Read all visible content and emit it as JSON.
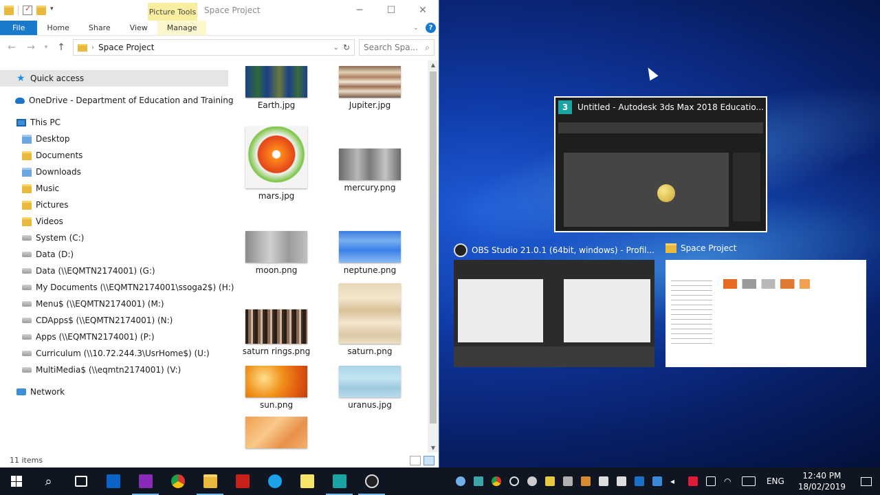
{
  "explorer": {
    "picture_tools_label": "Picture Tools",
    "title": "Space Project",
    "ribbon_tabs": [
      "File",
      "Home",
      "Share",
      "View",
      "Manage"
    ],
    "address_path": "Space Project",
    "search_placeholder": "Search Spa...",
    "nav": {
      "quick_access": "Quick access",
      "onedrive": "OneDrive - Department of Education and Training",
      "this_pc": "This PC",
      "pc_items": [
        "Desktop",
        "Documents",
        "Downloads",
        "Music",
        "Pictures",
        "Videos",
        "System (C:)",
        "Data (D:)",
        "Data (\\\\EQMTN2174001) (G:)",
        "My Documents (\\\\EQMTN2174001\\ssoga2$) (H:)",
        "Menu$ (\\\\EQMTN2174001) (M:)",
        "CDApps$ (\\\\EQMTN2174001) (N:)",
        "Apps (\\\\EQMTN2174001) (P:)",
        "Curriculum (\\\\10.72.244.3\\UsrHome$) (U:)",
        "MultiMedia$ (\\\\eqmtn2174001) (V:)"
      ],
      "network": "Network"
    },
    "files": [
      {
        "name": "Earth.jpg"
      },
      {
        "name": "Jupiter.jpg"
      },
      {
        "name": "mars.jpg"
      },
      {
        "name": "mercury.png"
      },
      {
        "name": "moon.png"
      },
      {
        "name": "neptune.png"
      },
      {
        "name": "saturn rings.png"
      },
      {
        "name": "saturn.png"
      },
      {
        "name": "sun.png"
      },
      {
        "name": "uranus.jpg"
      },
      {
        "name": ""
      }
    ],
    "status": "11 items"
  },
  "task_view": {
    "windows": [
      {
        "title": "Untitled - Autodesk 3ds Max 2018 Educatio...",
        "icon": "3ds-max-icon"
      },
      {
        "title": "OBS Studio 21.0.1 (64bit, windows) - Profil...",
        "icon": "obs-icon"
      },
      {
        "title": "Space Project",
        "icon": "folder-icon"
      }
    ]
  },
  "taskbar": {
    "language": "ENG",
    "time": "12:40 PM",
    "date": "18/02/2019"
  }
}
